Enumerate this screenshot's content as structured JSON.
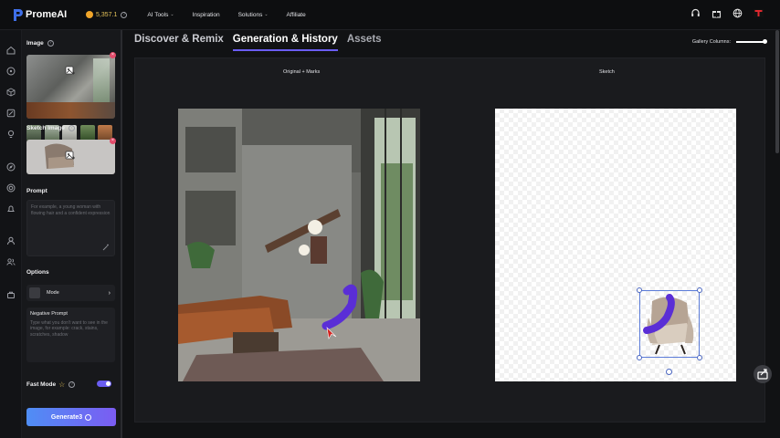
{
  "brand": {
    "name": "PromeAI"
  },
  "header": {
    "credits": "5,357.1",
    "nav": [
      {
        "label": "AI Tools",
        "has_menu": true
      },
      {
        "label": "Inspiration",
        "has_menu": false
      },
      {
        "label": "Solutions",
        "has_menu": true
      },
      {
        "label": "Affiliate",
        "has_menu": false
      }
    ],
    "icons": [
      "headset-icon",
      "gift-icon",
      "globe-icon",
      "avatar"
    ]
  },
  "rail": {
    "icons": [
      "home-icon",
      "compass-icon",
      "cube-icon",
      "brush-icon",
      "bulb-icon",
      "explore-icon",
      "target-icon",
      "bell-icon",
      "user-icon",
      "team-icon",
      "bag-icon"
    ]
  },
  "panel": {
    "image_label": "Image",
    "sketch_label": "Sketch Image",
    "prompt_label": "Prompt",
    "prompt_placeholder": "For example, a young woman with flowing hair and a confident expression",
    "options_label": "Options",
    "mode_label": "Mode",
    "negative_title": "Negative Prompt",
    "negative_placeholder": "Type what you don't want to see in the image, for example: crack, stains, scratches, shadow",
    "fast_mode_label": "Fast Mode",
    "fast_mode_on": true,
    "generate_label": "Generate3"
  },
  "tabs": [
    {
      "label": "Discover & Remix",
      "active": false
    },
    {
      "label": "Generation & History",
      "active": true
    },
    {
      "label": "Assets",
      "active": false
    }
  ],
  "gallery_label": "Gallery Columns:",
  "stage": {
    "left_caption": "Original + Marks",
    "right_caption": "Sketch"
  },
  "colors": {
    "accent": "#6a5df2",
    "stroke": "#5a2ed6",
    "credits": "#e7c45a"
  }
}
